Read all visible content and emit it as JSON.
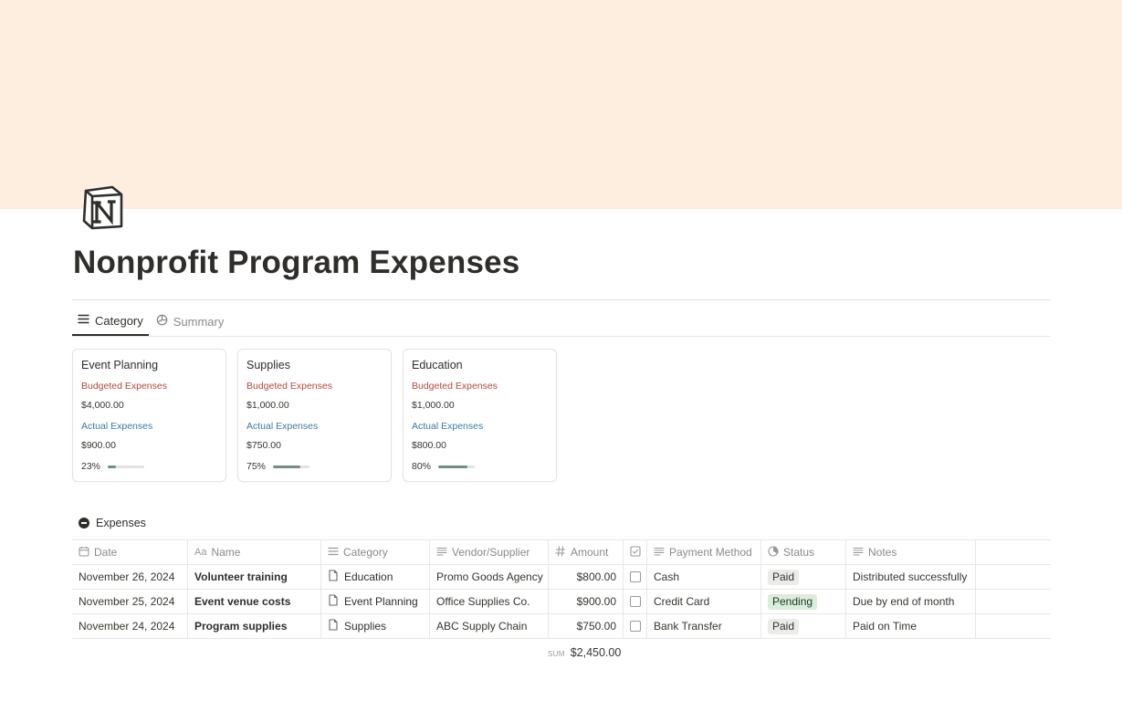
{
  "page": {
    "title": "Nonprofit Program Expenses",
    "cover_color": "#feeee0",
    "icon": "notion-logo-icon"
  },
  "tabs": [
    {
      "label": "Category",
      "icon": "list-icon",
      "active": true
    },
    {
      "label": "Summary",
      "icon": "chart-icon",
      "active": false
    }
  ],
  "cards": [
    {
      "title": "Event Planning",
      "budget_label": "Budgeted Expenses",
      "budget_value": "$4,000.00",
      "actual_label": "Actual Expenses",
      "actual_value": "$900.00",
      "percent_label": "23%",
      "percent": 0.23
    },
    {
      "title": "Supplies",
      "budget_label": "Budgeted Expenses",
      "budget_value": "$1,000.00",
      "actual_label": "Actual Expenses",
      "actual_value": "$750.00",
      "percent_label": "75%",
      "percent": 0.75
    },
    {
      "title": "Education",
      "budget_label": "Budgeted Expenses",
      "budget_value": "$1,000.00",
      "actual_label": "Actual Expenses",
      "actual_value": "$800.00",
      "percent_label": "80%",
      "percent": 0.8
    }
  ],
  "colors": {
    "budget_label": "#b24a3d",
    "actual_label": "#3e79a1",
    "progress_fill": "#6f8f80",
    "pill_paid": "#ebebea",
    "pill_pending": "#dbeddb"
  },
  "database": {
    "title": "Expenses",
    "columns": {
      "date": "Date",
      "name": "Name",
      "name_icon_text": "Aa",
      "category": "Category",
      "vendor": "Vendor/Supplier",
      "amount": "Amount",
      "payment": "Payment Method",
      "status": "Status",
      "notes": "Notes"
    },
    "rows": [
      {
        "date": "November 26, 2024",
        "name": "Volunteer training",
        "category": "Education",
        "vendor": "Promo Goods Agency",
        "amount": "$800.00",
        "checked": false,
        "payment": "Cash",
        "status": "Paid",
        "notes": "Distributed successfully"
      },
      {
        "date": "November 25, 2024",
        "name": "Event venue costs",
        "category": "Event Planning",
        "vendor": "Office Supplies Co.",
        "amount": "$900.00",
        "checked": false,
        "payment": "Credit Card",
        "status": "Pending",
        "notes": "Due by end of month"
      },
      {
        "date": "November 24, 2024",
        "name": "Program supplies",
        "category": "Supplies",
        "vendor": "ABC Supply Chain",
        "amount": "$750.00",
        "checked": false,
        "payment": "Bank Transfer",
        "status": "Paid",
        "notes": "Paid on Time"
      }
    ],
    "sum_label": "SUM",
    "sum_value": "$2,450.00"
  }
}
